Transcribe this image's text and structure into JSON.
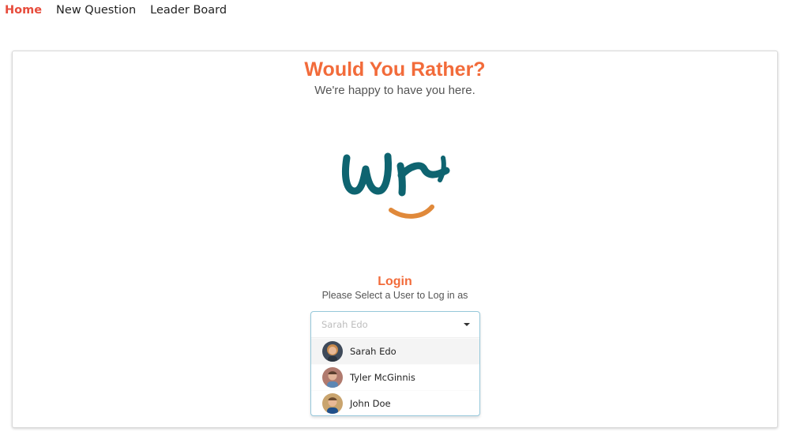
{
  "nav": {
    "home": "Home",
    "new_question": "New Question",
    "leader_board": "Leader Board"
  },
  "card": {
    "title": "Would You Rather?",
    "subtitle": "We're happy to have you here.",
    "logo": {
      "text": "wr",
      "colors": {
        "letters": "#0e6470",
        "smile": "#e0893a"
      }
    },
    "login": {
      "heading": "Login",
      "instruction": "Please Select a User to Log in as"
    },
    "user_select": {
      "selected_value": "Sarah Edo",
      "options": [
        {
          "label": "Sarah Edo",
          "avatar": "avatar-woman-icon"
        },
        {
          "label": "Tyler McGinnis",
          "avatar": "avatar-man-icon"
        },
        {
          "label": "John Doe",
          "avatar": "avatar-man-icon"
        }
      ]
    }
  },
  "colors": {
    "accent": "#f26b3a",
    "active_nav": "#e74c3c",
    "dropdown_border": "#96c8da"
  }
}
